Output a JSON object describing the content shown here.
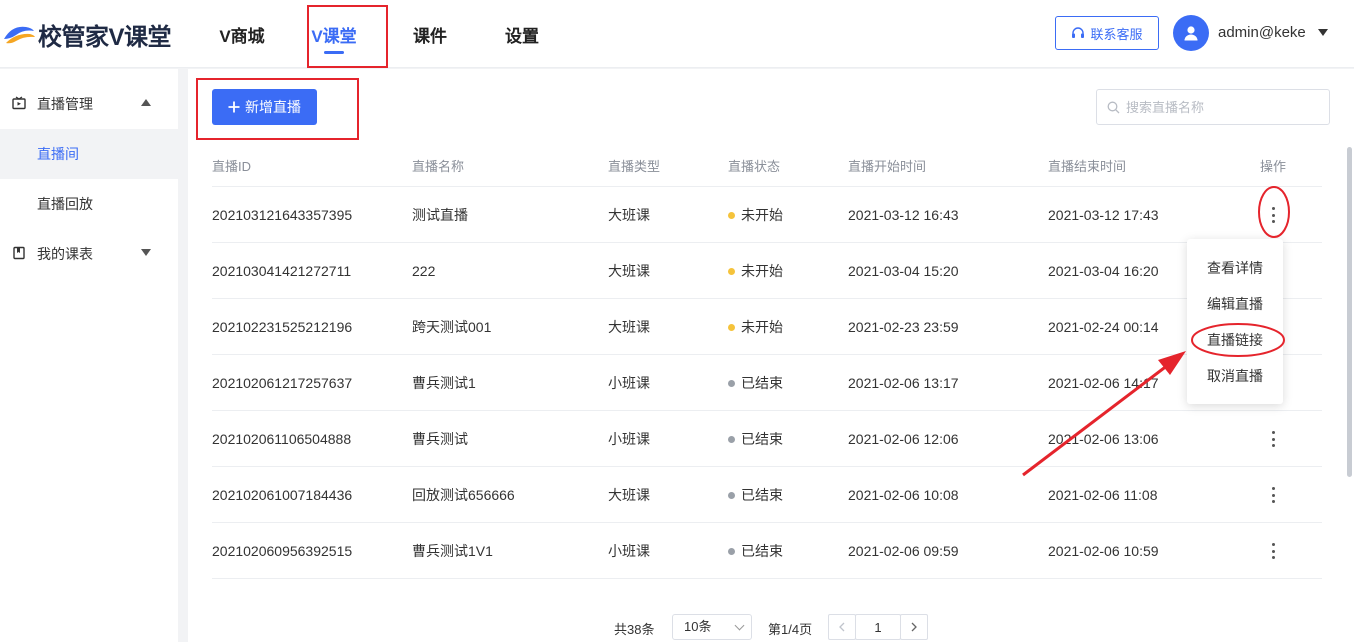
{
  "header": {
    "logo_text": "校管家V课堂",
    "nav": [
      "V商城",
      "V课堂",
      "课件",
      "设置"
    ],
    "active_nav": 1,
    "contact_label": "联系客服",
    "user_name": "admin@keke"
  },
  "sidebar": {
    "group_live": "直播管理",
    "items": [
      "直播间",
      "直播回放"
    ],
    "group_schedule": "我的课表"
  },
  "toolbar": {
    "add_label": "新增直播",
    "search_placeholder": "搜索直播名称"
  },
  "table": {
    "columns": [
      "直播ID",
      "直播名称",
      "直播类型",
      "直播状态",
      "直播开始时间",
      "直播结束时间",
      "操作"
    ],
    "rows": [
      {
        "id": "202103121643357395",
        "name": "测试直播",
        "type": "大班课",
        "status": "未开始",
        "start": "2021-03-12 16:43",
        "end": "2021-03-12 17:43"
      },
      {
        "id": "202103041421272711",
        "name": "222",
        "type": "大班课",
        "status": "未开始",
        "start": "2021-03-04 15:20",
        "end": "2021-03-04 16:20"
      },
      {
        "id": "202102231525212196",
        "name": "跨天测试001",
        "type": "大班课",
        "status": "未开始",
        "start": "2021-02-23 23:59",
        "end": "2021-02-24 00:14"
      },
      {
        "id": "202102061217257637",
        "name": "曹兵测试1",
        "type": "小班课",
        "status": "已结束",
        "start": "2021-02-06 13:17",
        "end": "2021-02-06 14:17"
      },
      {
        "id": "202102061106504888",
        "name": "曹兵测试",
        "type": "小班课",
        "status": "已结束",
        "start": "2021-02-06 12:06",
        "end": "2021-02-06 13:06"
      },
      {
        "id": "202102061007184436",
        "name": "回放测试656666",
        "type": "大班课",
        "status": "已结束",
        "start": "2021-02-06 10:08",
        "end": "2021-02-06 11:08"
      },
      {
        "id": "202102060956392515",
        "name": "曹兵测试1V1",
        "type": "小班课",
        "status": "已结束",
        "start": "2021-02-06 09:59",
        "end": "2021-02-06 10:59"
      }
    ]
  },
  "status_colors": {
    "未开始": "#f5c33b",
    "已结束": "#9aa0a8"
  },
  "menu": {
    "items": [
      "查看详情",
      "编辑直播",
      "直播链接",
      "取消直播"
    ]
  },
  "pagination": {
    "total": "共38条",
    "page_size": "10条",
    "page_info": "第1/4页",
    "current": "1"
  },
  "colors": {
    "accent": "#3b6cf5",
    "annotation": "#e5242c"
  }
}
